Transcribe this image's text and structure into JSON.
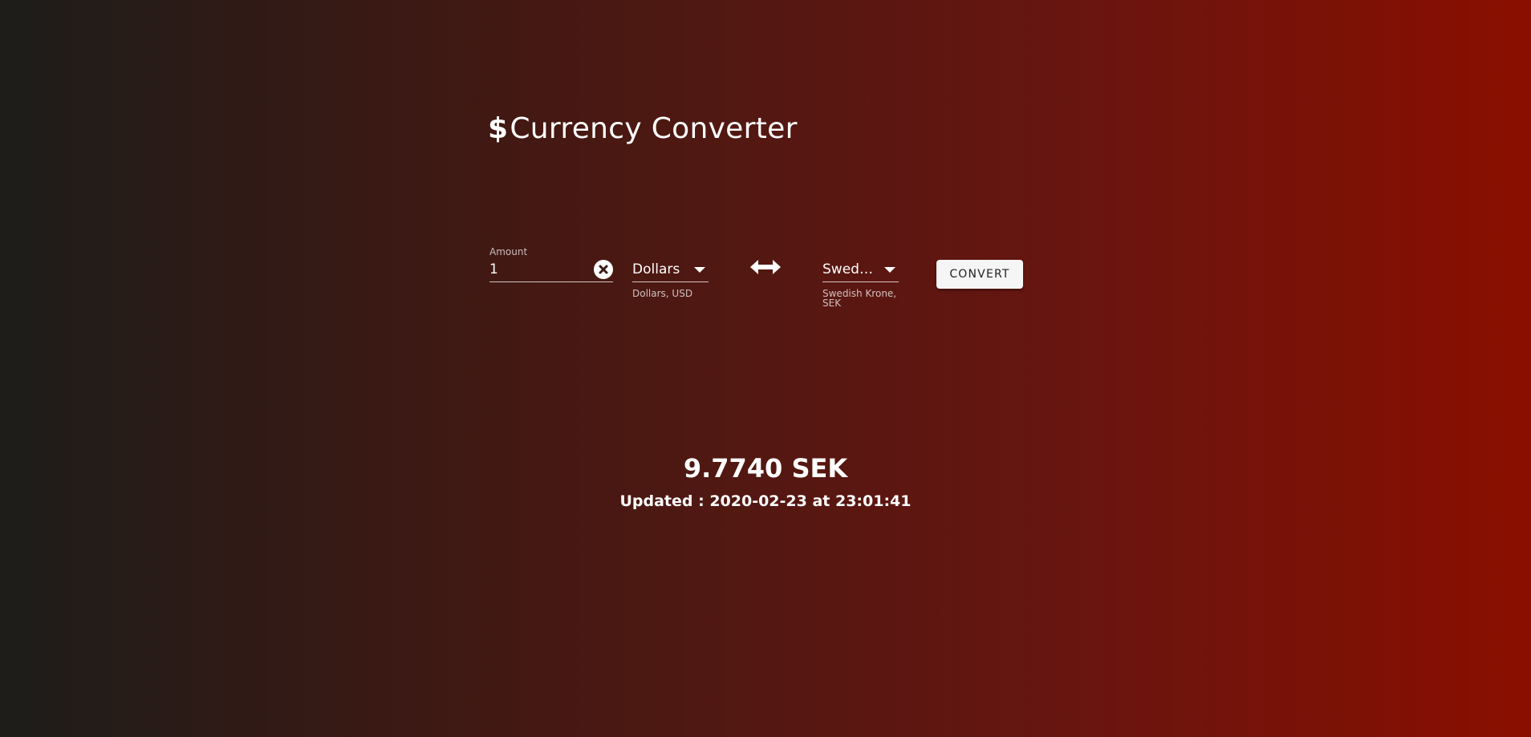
{
  "header": {
    "icon": "dollar-icon",
    "icon_glyph": "$",
    "title": "Currency Converter"
  },
  "amount": {
    "label": "Amount",
    "value": "1"
  },
  "from_currency": {
    "selected": "Dollars",
    "helper": "Dollars, USD"
  },
  "to_currency": {
    "selected": "Swed…",
    "helper": "Swedish Krone, SEK"
  },
  "actions": {
    "convert_label": "CONVERT"
  },
  "result": {
    "converted": "9.7740 SEK",
    "updated": "Updated : 2020-02-23 at 23:01:41"
  },
  "colors": {
    "background_start": "#1d1d1a",
    "background_end": "#8a0f00",
    "button_bg": "#f5f5f5",
    "text": "#ffffff"
  }
}
